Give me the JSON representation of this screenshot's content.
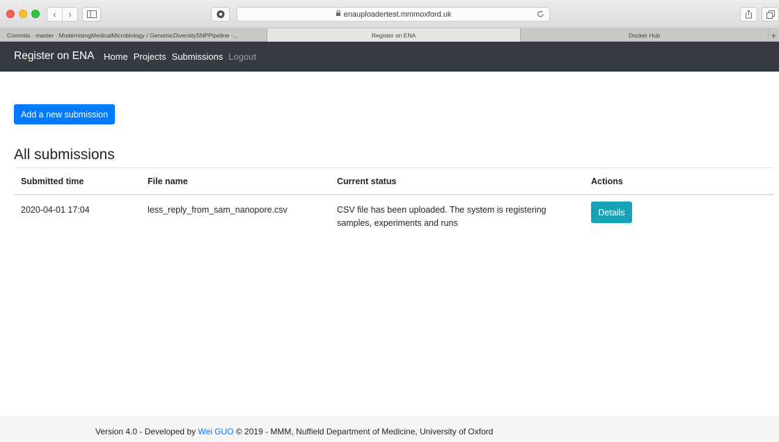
{
  "browser": {
    "url": "enauploadertest.mmmoxford.uk",
    "tabs": [
      {
        "title": "Commits · master · ModernisingMedicalMicrobiology / GenomicDiversitySNPPipeline ·..."
      },
      {
        "title": "Register on ENA"
      },
      {
        "title": "Docker Hub"
      }
    ],
    "new_tab": "+",
    "icons": [
      "back-icon",
      "forward-icon",
      "sidebar-icon",
      "shield-icon",
      "lock-icon",
      "reload-icon",
      "share-icon",
      "tabs-icon"
    ]
  },
  "navbar": {
    "brand": "Register on ENA",
    "links": [
      "Home",
      "Projects",
      "Submissions",
      "Logout"
    ]
  },
  "main": {
    "add_button": "Add a new submission",
    "heading": "All submissions",
    "columns": [
      "Submitted time",
      "File name",
      "Current status",
      "Actions"
    ],
    "rows": [
      {
        "time": "2020-04-01 17:04",
        "file": "less_reply_from_sam_nanopore.csv",
        "status": "CSV file has been uploaded. The system is registering samples, experiments and runs",
        "action": "Details"
      }
    ]
  },
  "footer": {
    "prefix": "Version 4.0 - Developed by ",
    "author": "Wei GUO",
    "suffix": " © 2019 - MMM, Nuffield Department of Medicine, University of Oxford"
  },
  "colors": {
    "navbar_bg": "#343a40",
    "primary": "#007bff",
    "info": "#17a2b8",
    "footer_bg": "#f5f5f5"
  }
}
